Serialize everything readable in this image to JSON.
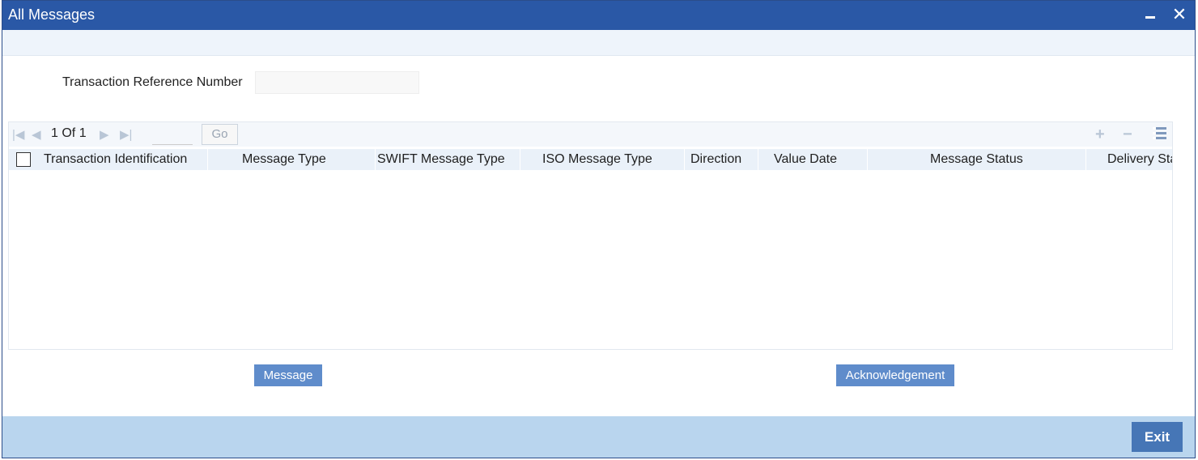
{
  "window": {
    "title": "All Messages"
  },
  "form": {
    "reference_label": "Transaction Reference Number",
    "reference_value": ""
  },
  "pager": {
    "current": "1",
    "of_label": "Of",
    "total": "1",
    "go_label": "Go",
    "page_input_value": ""
  },
  "grid": {
    "columns": [
      "Transaction Identification",
      "Message Type",
      "SWIFT Message Type",
      "ISO Message Type",
      "Direction",
      "Value Date",
      "Message Status",
      "Delivery Status"
    ],
    "rows": []
  },
  "buttons": {
    "message": "Message",
    "acknowledgement": "Acknowledgement",
    "exit": "Exit"
  },
  "colors": {
    "title_bar": "#2a58a6",
    "button": "#5f8ccb",
    "footer": "#b9d5ee",
    "exit_button": "#4676b6"
  },
  "icons": {
    "minimize": "minimize-icon",
    "close": "close-icon",
    "first_page": "first-page-icon",
    "prev_page": "previous-page-icon",
    "next_page": "next-page-icon",
    "last_page": "last-page-icon",
    "add_row": "add-row-icon",
    "delete_row": "delete-row-icon",
    "columns": "columns-icon"
  }
}
